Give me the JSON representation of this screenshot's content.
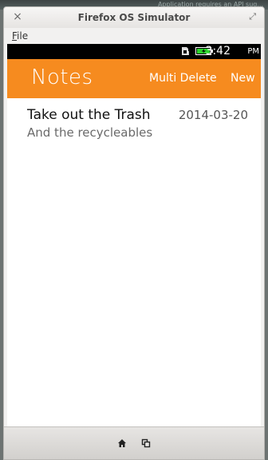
{
  "desktop": {
    "ghost_text": "Application requires an API sug..."
  },
  "window": {
    "title": "Firefox OS Simulator",
    "close_glyph": "×",
    "maximize_glyph": "⤢",
    "menu": {
      "file_first": "F",
      "file_rest": "ile"
    }
  },
  "status_bar": {
    "time": "3:42",
    "ampm": "PM",
    "icons": [
      "sim-icon",
      "battery-charging-icon"
    ],
    "battery_color": "#2bd52b"
  },
  "app": {
    "title": "Notes",
    "accent_color": "#f68b1f",
    "actions": {
      "multi_delete": "Multi Delete",
      "new": "New"
    },
    "notes": [
      {
        "title": "Take out the Trash",
        "date": "2014-03-20",
        "body": "And the recycleables"
      }
    ]
  },
  "bottom_bar": {
    "icons": [
      "home-icon",
      "rotate-icon"
    ]
  }
}
